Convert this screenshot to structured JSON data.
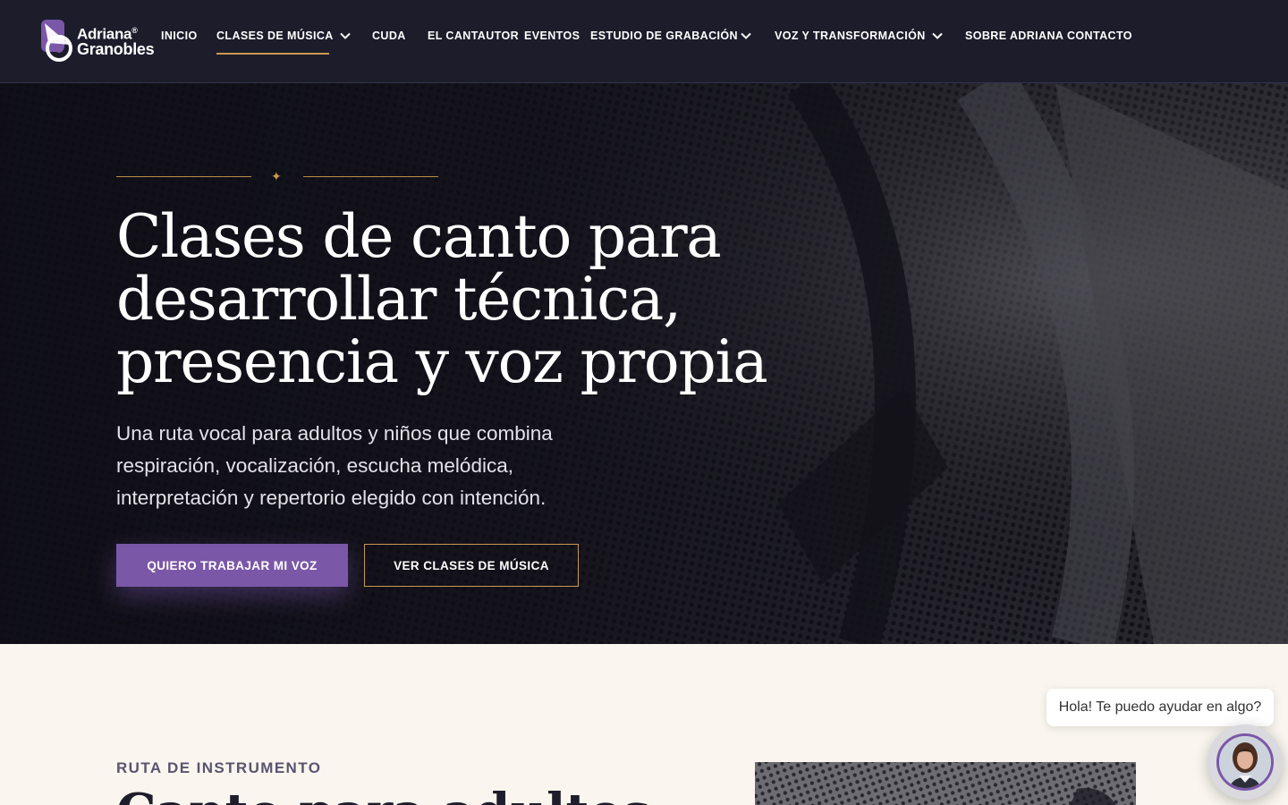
{
  "brand": {
    "line1": "Adriana",
    "trademark": "®",
    "line2": "Granobles",
    "accent_color": "#7b57a8",
    "gold_color": "#c99a50"
  },
  "nav": {
    "items": [
      {
        "label": "INICIO"
      },
      {
        "label": "CLASES DE MÚSICA",
        "active": true,
        "dropdown": true
      },
      {
        "label": "CUDA"
      },
      {
        "label": "EL CANTAUTOR"
      },
      {
        "label": "EVENTOS"
      },
      {
        "label": "ESTUDIO DE GRABACIÓN",
        "dropdown": true
      },
      {
        "label": "VOZ Y TRANSFORMACIÓN",
        "dropdown": true
      },
      {
        "label": "SOBRE ADRIANA"
      },
      {
        "label": "CONTACTO"
      }
    ]
  },
  "hero": {
    "title_lines": [
      "Clases de canto para",
      "desarrollar técnica,",
      "presencia y voz propia"
    ],
    "subtitle_lines": [
      "Una ruta vocal para adultos y niños que combina",
      "respiración, vocalización, escucha melódica,",
      "interpretación y repertorio elegido con intención."
    ],
    "primary_cta": "QUIERO TRABAJAR MI VOZ",
    "secondary_cta": "VER CLASES DE MÚSICA",
    "divider_ornament": "✦"
  },
  "section2": {
    "eyebrow": "RUTA DE INSTRUMENTO",
    "title": "Canto para adultos"
  },
  "chat": {
    "greeting": "Hola! Te puedo ayudar en algo?"
  }
}
